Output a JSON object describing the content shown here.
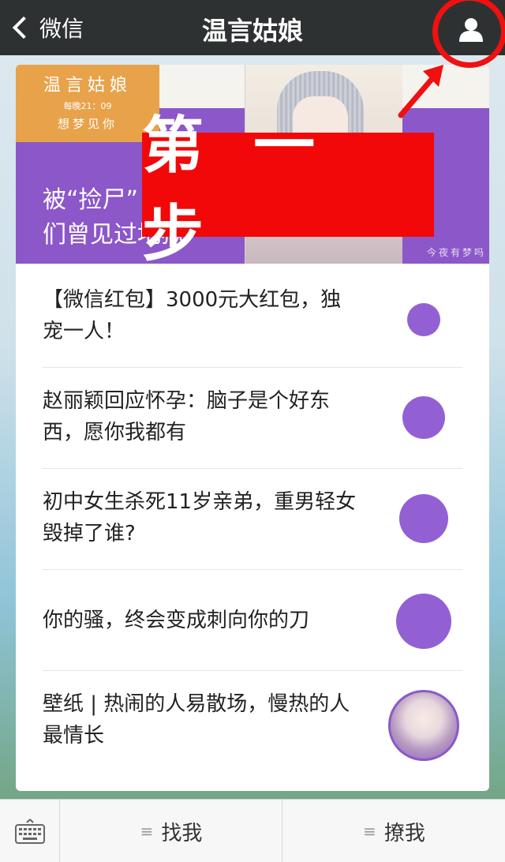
{
  "nav": {
    "back_label": "微信",
    "title": "温言姑娘",
    "profile_icon": "person-icon"
  },
  "annotation": {
    "step_label": "第 一 步",
    "highlight_color": "#f01010"
  },
  "banner": {
    "stamp_title": "温言姑娘",
    "stamp_time": "每晚21：09",
    "stamp_sub": "想梦见你",
    "headline": "被“捡尸”　　　　　　　　　　　吧\n们曾见过地狱",
    "corner_text": "今夜有梦吗"
  },
  "articles": [
    {
      "title": "【微信红包】3000元大红包，独宠一人！",
      "thumb": "purple-circle"
    },
    {
      "title": "赵丽颖回应怀孕：脑子是个好东西，愿你我都有",
      "thumb": "purple-circle"
    },
    {
      "title": "初中女生杀死11岁亲弟，重男轻女毁掉了谁?",
      "thumb": "purple-circle"
    },
    {
      "title": "你的骚，终会变成刺向你的刀",
      "thumb": "purple-circle"
    },
    {
      "title": "壁纸 | 热闹的人易散场，慢热的人最情长",
      "thumb": "girl-illustration"
    }
  ],
  "tabbar": {
    "keyboard_icon": "keyboard-icon",
    "tabs": [
      {
        "label": "找我",
        "icon": "menu-lines-icon"
      },
      {
        "label": "撩我",
        "icon": "menu-lines-icon"
      }
    ]
  },
  "colors": {
    "nav_bg": "#2e3132",
    "banner_purple": "#8c57c9",
    "thumb_purple": "#9360d4",
    "stamp_orange": "#e8a24a",
    "step_red": "#f20808"
  }
}
